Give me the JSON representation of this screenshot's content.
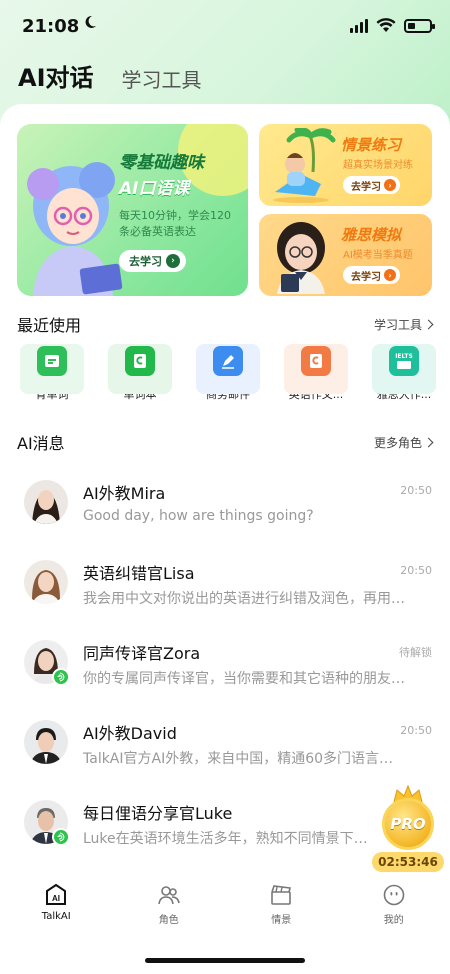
{
  "status": {
    "time": "21:08"
  },
  "header": {
    "tab_active": "AI对话",
    "tab_inactive": "学习工具"
  },
  "banners": {
    "main": {
      "title1": "零基础趣味",
      "title2": "AI口语课",
      "desc": "每天10分钟，学会120条必备英语表达",
      "button": "去学习"
    },
    "side1": {
      "title": "情景练习",
      "desc": "超真实场景对练",
      "button": "去学习"
    },
    "side2": {
      "title": "雅思模拟",
      "desc": "AI模考当季真题",
      "button": "去学习"
    }
  },
  "recent": {
    "title": "最近使用",
    "more": "学习工具",
    "items": [
      {
        "label": "背单词",
        "icon": "flashcard-icon",
        "color": "#2fbf5a",
        "tile": "#e8f8ec"
      },
      {
        "label": "单词本",
        "icon": "wordbook-icon",
        "color": "#22b84a",
        "tile": "#e6f7ea"
      },
      {
        "label": "商务邮件",
        "icon": "mail-pen-icon",
        "color": "#3d8cf0",
        "tile": "#e8f1fd"
      },
      {
        "label": "英语作文...",
        "icon": "essay-icon",
        "color": "#f27a45",
        "tile": "#fdeee6"
      },
      {
        "label": "雅思大作...",
        "icon": "ielts-icon",
        "color": "#1fbf9c",
        "tile": "#e3f7f2",
        "badge": "IELTS"
      }
    ]
  },
  "messages": {
    "title": "AI消息",
    "more": "更多角色",
    "items": [
      {
        "name": "AI外教Mira",
        "time": "20:50",
        "preview": "Good day, how are things going?"
      },
      {
        "name": "英语纠错官Lisa",
        "time": "20:50",
        "preview": "我会用中文对你说出的英语进行纠错及润色，再用…"
      },
      {
        "name": "同声传译官Zora",
        "time": "待解锁",
        "preview": "你的专属同声传译官，当你需要和其它语种的朋友…"
      },
      {
        "name": "AI外教David",
        "time": "20:50",
        "preview": "TalkAI官方AI外教，来自中国，精通60多门语言…"
      },
      {
        "name": "每日俚语分享官Luke",
        "time": "",
        "preview": "Luke在英语环境生活多年，熟知不同情景下…"
      }
    ]
  },
  "pro": {
    "label": "PRO",
    "timer": "02:53:46"
  },
  "tabbar": {
    "items": [
      {
        "label": "TalkAI",
        "icon": "talkai-icon",
        "badge": "AI"
      },
      {
        "label": "角色",
        "icon": "people-icon"
      },
      {
        "label": "情景",
        "icon": "clapperboard-icon"
      },
      {
        "label": "我的",
        "icon": "profile-icon"
      }
    ]
  }
}
